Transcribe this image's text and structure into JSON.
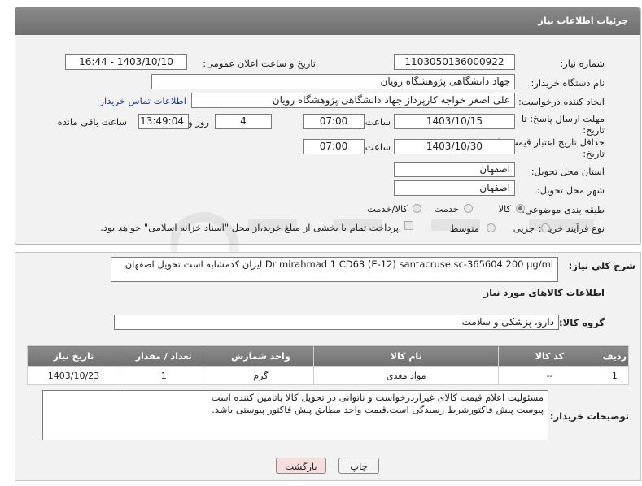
{
  "header": {
    "title": "جزئیات اطلاعات نیاز"
  },
  "form": {
    "need_number_label": "شماره نیاز:",
    "need_number": "1103050136000922",
    "announce_label": "تاریخ و ساعت اعلان عمومی:",
    "announce_value": "1403/10/10 - 16:44",
    "buyer_org_label": "نام دستگاه خریدار:",
    "buyer_org": "جهاد دانشگاهی پژوهشگاه رویان",
    "creator_label": "ایجاد کننده درخواست:",
    "creator": "علی اصغر خواجه کارپرداز جهاد دانشگاهی پژوهشگاه رویان",
    "contact_link": "اطلاعات تماس خریدار",
    "deadline_label_1": "مهلت ارسال پاسخ: تا",
    "deadline_label_2": "تاریخ:",
    "deadline_date": "1403/10/15",
    "time_label": "ساعت",
    "deadline_time": "07:00",
    "days_value": "4",
    "days_label": "روز و",
    "remaining_time": "13:49:04",
    "remaining_label": "ساعت باقی مانده",
    "validity_label_1": "حداقل تاریخ اعتبار قیمت: تا",
    "validity_label_2": "تاریخ:",
    "validity_date": "1403/10/30",
    "validity_time": "07:00",
    "province_label": "استان محل تحویل:",
    "province": "اصفهان",
    "city_label": "شهر محل تحویل:",
    "city": "اصفهان",
    "category_label": "طبقه بندی موضوعی:",
    "category_options": [
      "کالا",
      "خدمت",
      "کالا/خدمت"
    ],
    "process_label": "نوع فرآیند خرید :",
    "process_options": [
      "جزیی",
      "متوسط"
    ],
    "treasury_note": "پرداخت تمام یا بخشی از مبلغ خرید،از محل \"اسناد خزانه اسلامی\" خواهد بود."
  },
  "summary": {
    "label": "شرح کلی نیاز:",
    "text": "Dr mirahmad     1     CD63 (E-12) santacruse  sc-365604  200 µg/ml ایران کدمشابه است    تحویل اصفهان"
  },
  "goods_info_title": "اطلاعات کالاهای مورد نیاز",
  "group": {
    "label": "گروه کالا:",
    "value": "دارو، پزشکی و سلامت"
  },
  "table": {
    "headers": [
      "ردیف",
      "کد کالا",
      "نام کالا",
      "واحد شمارش",
      "تعداد / مقدار",
      "تاریخ نیاز"
    ],
    "rows": [
      [
        "1",
        "--",
        "مواد مغذی",
        "گرم",
        "1",
        "1403/10/23"
      ]
    ]
  },
  "buyer_notes": {
    "label": "توضیحات خریدار:",
    "line1": "مسئولیت اعلام قیمت کالای غیرازدرخواست و ناتوانی در تحویل کالا باتامین کننده است",
    "line2": "پیوست پیش فاکتورشرط رسیدگی است.قیمت واحد مطابق پیش فاکتور پیوستی باشد."
  },
  "buttons": {
    "print": "چاپ",
    "back": "بازگشت"
  },
  "colors": {
    "header": "#7a7a7a",
    "link": "#1a3ea8",
    "back_button": "#f6dede"
  }
}
